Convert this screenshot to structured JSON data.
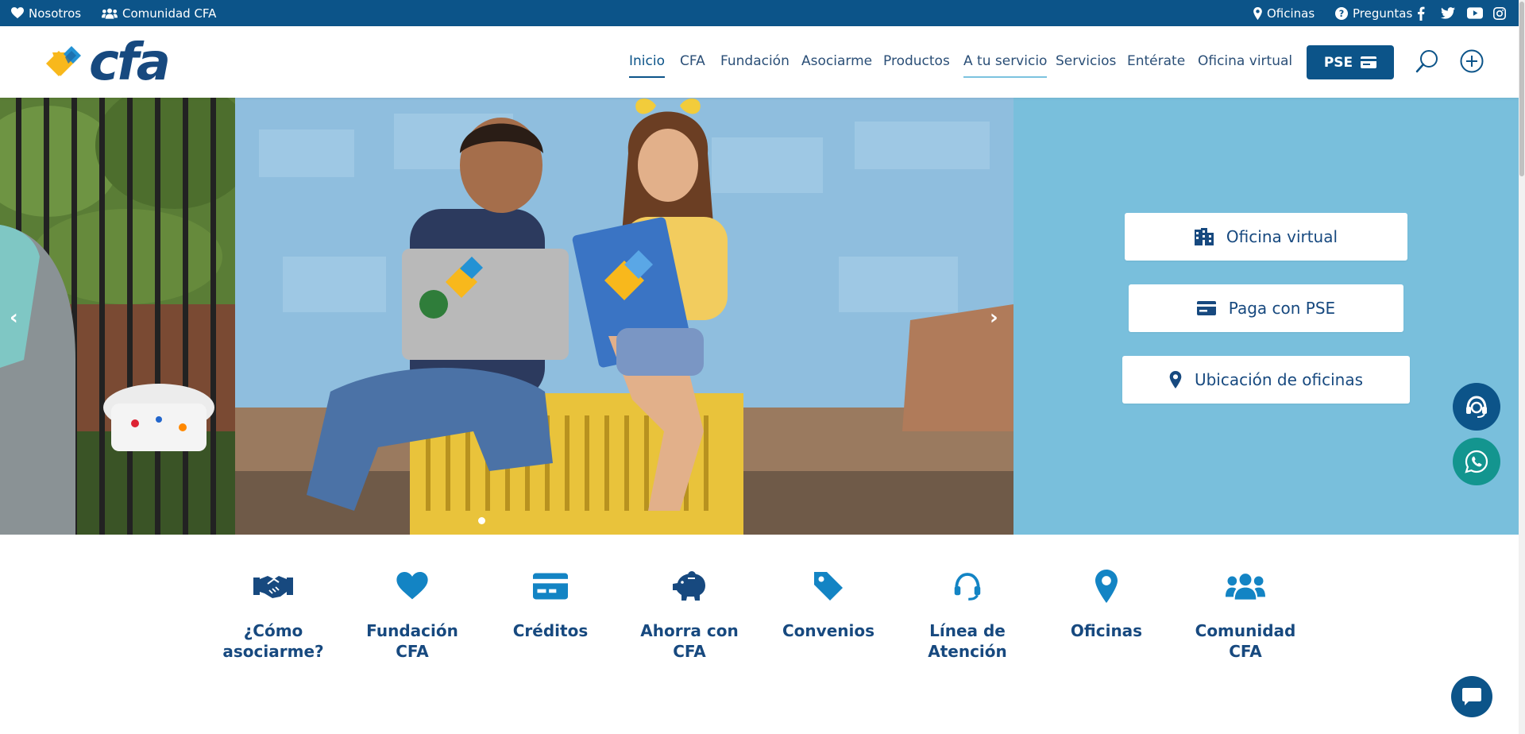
{
  "topbar": {
    "left_links": [
      {
        "label": "Nosotros",
        "icon": "heart-icon"
      },
      {
        "label": "Comunidad CFA",
        "icon": "users-icon"
      }
    ],
    "right_links": [
      {
        "label": "Oficinas",
        "icon": "map-pin-icon"
      },
      {
        "label": "Preguntas",
        "icon": "question-circle-icon"
      }
    ],
    "social": [
      "facebook-icon",
      "twitter-icon",
      "youtube-icon",
      "instagram-icon"
    ]
  },
  "header": {
    "logo_text": "cfa",
    "nav": [
      {
        "label": "Inicio"
      },
      {
        "label": "CFA"
      },
      {
        "label": "Fundación"
      },
      {
        "label": "Asociarme"
      },
      {
        "label": "Productos"
      },
      {
        "label": "A tu servicio"
      },
      {
        "label": "Servicios"
      },
      {
        "label": "Entérate"
      },
      {
        "label": "Oficina virtual"
      }
    ],
    "pse_label": "PSE"
  },
  "hero": {
    "panel_buttons": [
      {
        "label": "Oficina virtual",
        "icon": "building-icon"
      },
      {
        "label": "Paga con PSE",
        "icon": "credit-card-icon"
      },
      {
        "label": "Ubicación de oficinas",
        "icon": "map-pin-icon"
      }
    ],
    "carousel": {
      "prev_glyph": "‹",
      "next_glyph": "›",
      "slide_count": 1,
      "active_slide": 1
    }
  },
  "quick_links": [
    {
      "label": "¿Cómo asociarme?",
      "icon": "handshake-icon"
    },
    {
      "label": "Fundación CFA",
      "icon": "heart-icon"
    },
    {
      "label": "Créditos",
      "icon": "credit-card-icon"
    },
    {
      "label": "Ahorra con CFA",
      "icon": "piggy-bank-icon"
    },
    {
      "label": "Convenios",
      "icon": "tag-icon"
    },
    {
      "label": "Línea de Atención",
      "icon": "headset-icon"
    },
    {
      "label": "Oficinas",
      "icon": "map-pin-icon"
    },
    {
      "label": "Comunidad CFA",
      "icon": "users-icon"
    }
  ],
  "floating": [
    "headset-support-icon",
    "whatsapp-icon",
    "chat-icon"
  ],
  "colors": {
    "brand_dark": "#0c5489",
    "brand_text": "#17497f",
    "panel_light_blue": "#79bfdc",
    "logo_yellow": "#f8b81c",
    "logo_blue": "#2392d4",
    "whatsapp_teal": "#13958f"
  }
}
